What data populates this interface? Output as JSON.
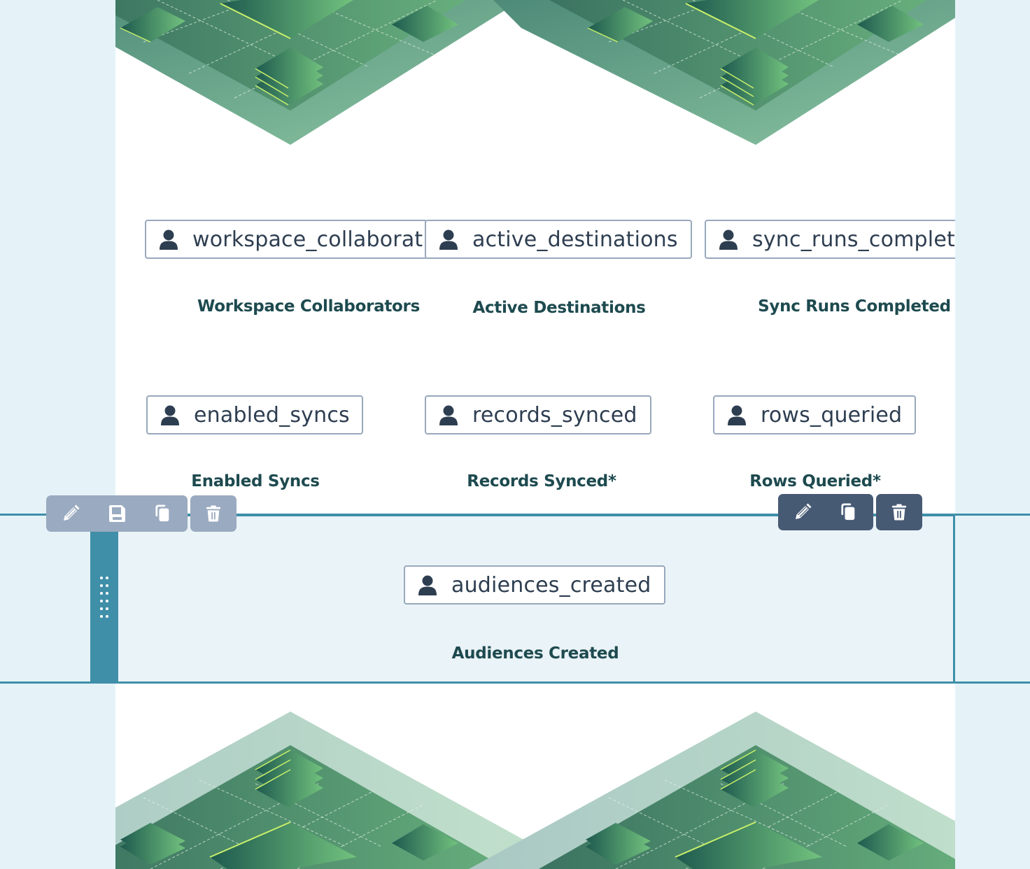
{
  "variables_row1": [
    {
      "token": "workspace_collaborat",
      "label": "Workspace Collaborators",
      "icon": "user-icon"
    },
    {
      "token": "active_destinations",
      "label": "Active Destinations",
      "icon": "user-icon"
    },
    {
      "token": "sync_runs_completed",
      "label": "Sync Runs Completed",
      "icon": "user-icon"
    }
  ],
  "variables_row2": [
    {
      "token": "enabled_syncs",
      "label": "Enabled Syncs",
      "icon": "user-icon"
    },
    {
      "token": "records_synced",
      "label": "Records Synced*",
      "icon": "user-icon"
    },
    {
      "token": "rows_queried",
      "label": "Rows Queried*",
      "icon": "user-icon"
    }
  ],
  "selected_section": {
    "token": "audiences_created",
    "label": "Audiences Created",
    "icon": "user-icon"
  },
  "section_toolbar": {
    "buttons": [
      "edit-icon",
      "save-icon",
      "copy-icon",
      "delete-icon"
    ]
  },
  "block_toolbar": {
    "buttons": [
      "edit-icon",
      "copy-icon",
      "delete-icon"
    ]
  },
  "colors": {
    "accent": "#3f8fa9",
    "label_text": "#1d4a4f",
    "token_text": "#2e3e51",
    "token_border": "#98a8bd",
    "toolbar_light": "#9aaac0",
    "toolbar_dark": "#475a74",
    "outer_background": "#e5f3f9",
    "selected_background": "#eaf3f7"
  }
}
